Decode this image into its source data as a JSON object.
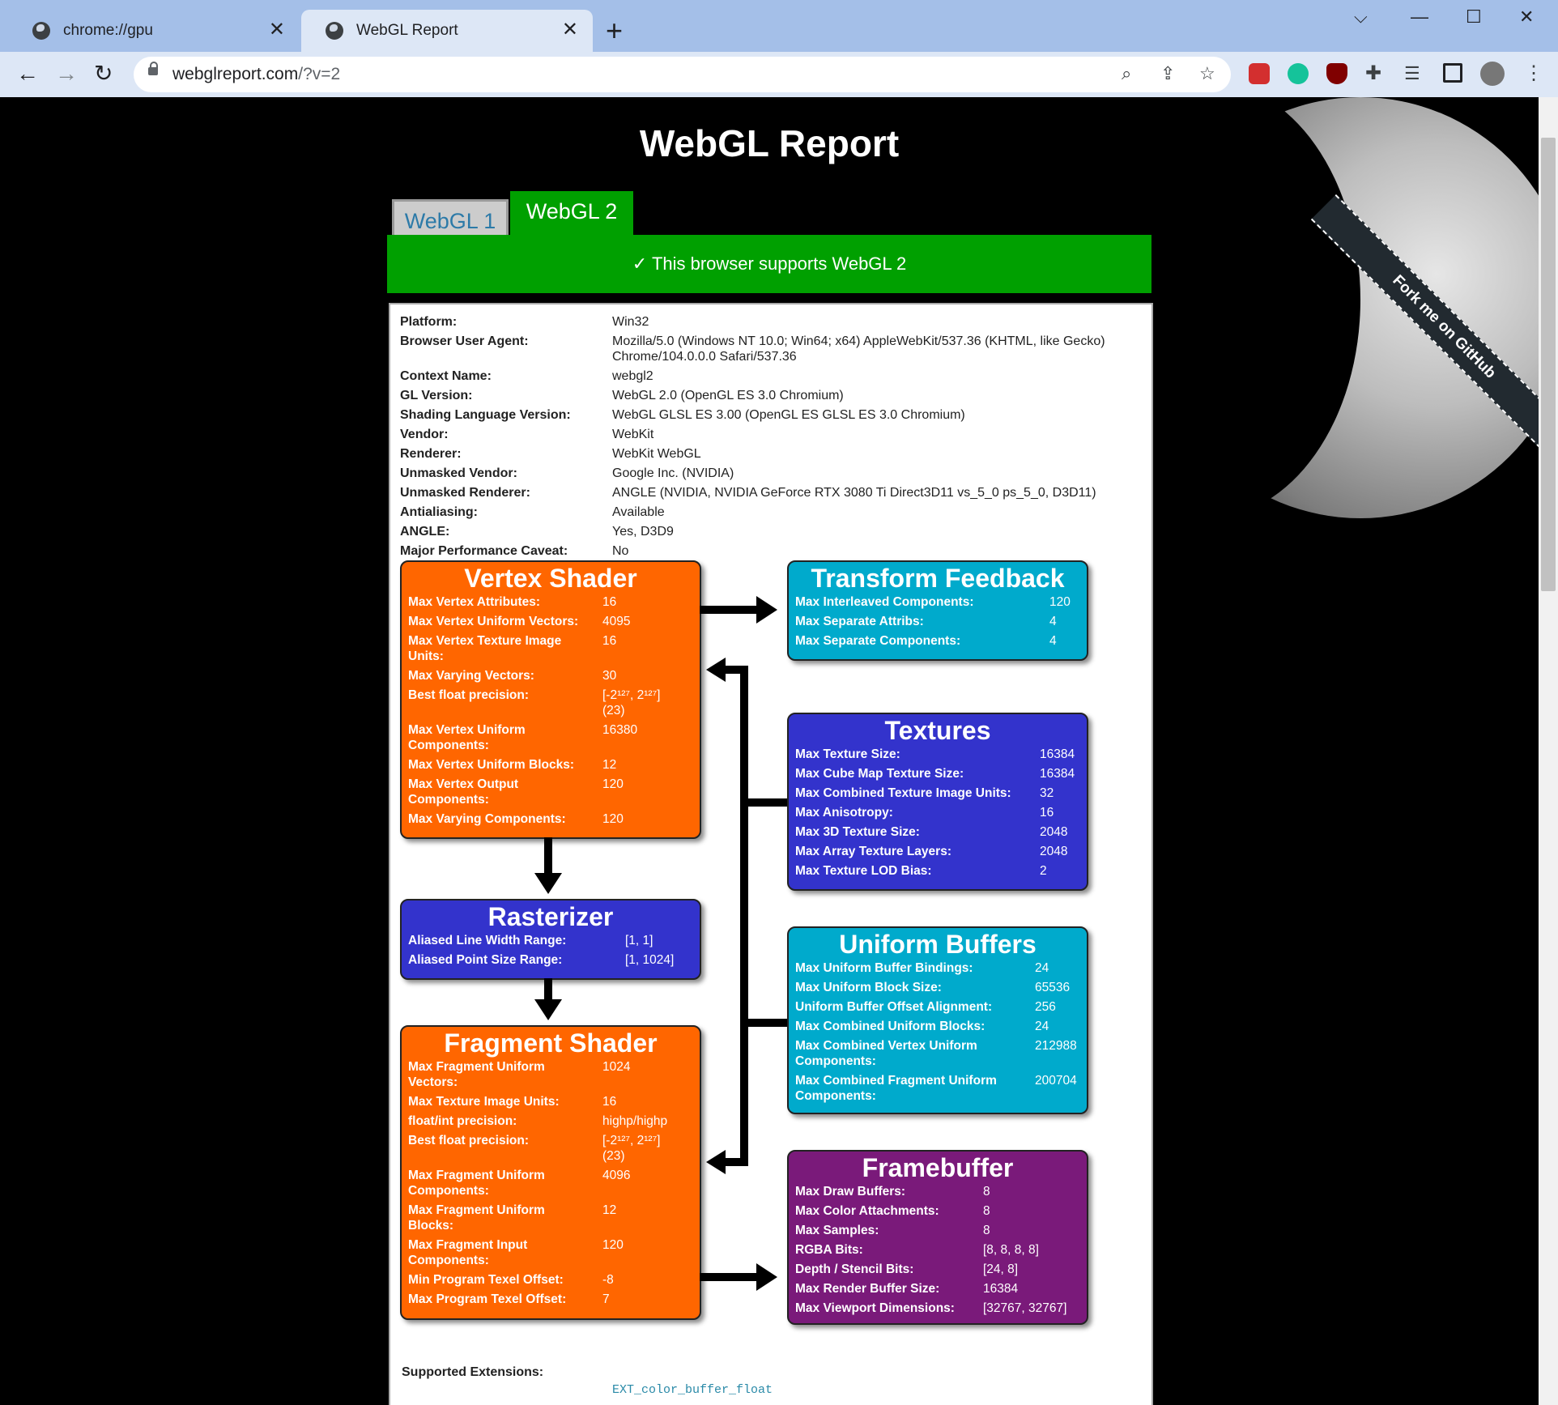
{
  "browser": {
    "tabs": [
      {
        "label": "chrome://gpu",
        "close": "✕"
      },
      {
        "label": "WebGL Report",
        "close": "✕"
      }
    ],
    "new_tab": "+",
    "window_controls": {
      "chevron": "⌵",
      "minimize": "—",
      "maximize": "☐",
      "close": "✕"
    },
    "url_host": "webglreport.com",
    "url_path": "/?v=2"
  },
  "page": {
    "title": "WebGL Report",
    "fork_ribbon": "Fork me on GitHub",
    "tabs": [
      "WebGL 1",
      "WebGL 2"
    ],
    "support_message": "✓ This browser supports WebGL 2",
    "info": [
      {
        "k": "Platform:",
        "v": "Win32"
      },
      {
        "k": "Browser User Agent:",
        "v": "Mozilla/5.0 (Windows NT 10.0; Win64; x64) AppleWebKit/537.36 (KHTML, like Gecko) Chrome/104.0.0.0 Safari/537.36"
      },
      {
        "k": "Context Name:",
        "v": "webgl2"
      },
      {
        "k": "GL Version:",
        "v": "WebGL 2.0 (OpenGL ES 3.0 Chromium)"
      },
      {
        "k": "Shading Language Version:",
        "v": "WebGL GLSL ES 3.00 (OpenGL ES GLSL ES 3.0 Chromium)"
      },
      {
        "k": "Vendor:",
        "v": "WebKit"
      },
      {
        "k": "Renderer:",
        "v": "WebKit WebGL"
      },
      {
        "k": "Unmasked Vendor:",
        "v": "Google Inc. (NVIDIA)"
      },
      {
        "k": "Unmasked Renderer:",
        "v": "ANGLE (NVIDIA, NVIDIA GeForce RTX 3080 Ti Direct3D11 vs_5_0 ps_5_0, D3D11)"
      },
      {
        "k": "Antialiasing:",
        "v": "Available"
      },
      {
        "k": "ANGLE:",
        "v": "Yes, D3D9"
      },
      {
        "k": "Major Performance Caveat:",
        "v": "No"
      }
    ],
    "vertex_shader": {
      "title": "Vertex Shader",
      "rows": [
        {
          "k": "Max Vertex Attributes:",
          "v": "16"
        },
        {
          "k": "Max Vertex Uniform Vectors:",
          "v": "4095"
        },
        {
          "k": "Max Vertex Texture Image Units:",
          "v": "16"
        },
        {
          "k": "Max Varying Vectors:",
          "v": "30"
        },
        {
          "k": "Best float precision:",
          "v": "[-2¹²⁷, 2¹²⁷] (23)"
        },
        {
          "k": "Max Vertex Uniform Components:",
          "v": "16380"
        },
        {
          "k": "Max Vertex Uniform Blocks:",
          "v": "12"
        },
        {
          "k": "Max Vertex Output Components:",
          "v": "120"
        },
        {
          "k": "Max Varying Components:",
          "v": "120"
        }
      ]
    },
    "rasterizer": {
      "title": "Rasterizer",
      "rows": [
        {
          "k": "Aliased Line Width Range:",
          "v": "[1, 1]"
        },
        {
          "k": "Aliased Point Size Range:",
          "v": "[1, 1024]"
        }
      ]
    },
    "fragment_shader": {
      "title": "Fragment Shader",
      "rows": [
        {
          "k": "Max Fragment Uniform Vectors:",
          "v": "1024"
        },
        {
          "k": "Max Texture Image Units:",
          "v": "16"
        },
        {
          "k": "float/int precision:",
          "v": "highp/highp"
        },
        {
          "k": "Best float precision:",
          "v": "[-2¹²⁷, 2¹²⁷] (23)"
        },
        {
          "k": "Max Fragment Uniform Components:",
          "v": "4096"
        },
        {
          "k": "Max Fragment Uniform Blocks:",
          "v": "12"
        },
        {
          "k": "Max Fragment Input Components:",
          "v": "120"
        },
        {
          "k": "Min Program Texel Offset:",
          "v": "-8"
        },
        {
          "k": "Max Program Texel Offset:",
          "v": "7"
        }
      ]
    },
    "transform_feedback": {
      "title": "Transform Feedback",
      "rows": [
        {
          "k": "Max Interleaved Components:",
          "v": "120"
        },
        {
          "k": "Max Separate Attribs:",
          "v": "4"
        },
        {
          "k": "Max Separate Components:",
          "v": "4"
        }
      ]
    },
    "textures": {
      "title": "Textures",
      "rows": [
        {
          "k": "Max Texture Size:",
          "v": "16384"
        },
        {
          "k": "Max Cube Map Texture Size:",
          "v": "16384"
        },
        {
          "k": "Max Combined Texture Image Units:",
          "v": "32"
        },
        {
          "k": "Max Anisotropy:",
          "v": "16"
        },
        {
          "k": "Max 3D Texture Size:",
          "v": "2048"
        },
        {
          "k": "Max Array Texture Layers:",
          "v": "2048"
        },
        {
          "k": "Max Texture LOD Bias:",
          "v": "2"
        }
      ]
    },
    "uniform_buffers": {
      "title": "Uniform Buffers",
      "rows": [
        {
          "k": "Max Uniform Buffer Bindings:",
          "v": "24"
        },
        {
          "k": "Max Uniform Block Size:",
          "v": "65536"
        },
        {
          "k": "Uniform Buffer Offset Alignment:",
          "v": "256"
        },
        {
          "k": "Max Combined Uniform Blocks:",
          "v": "24"
        },
        {
          "k": "Max Combined Vertex Uniform Components:",
          "v": "212988"
        },
        {
          "k": "Max Combined Fragment Uniform Components:",
          "v": "200704"
        }
      ]
    },
    "framebuffer": {
      "title": "Framebuffer",
      "rows": [
        {
          "k": "Max Draw Buffers:",
          "v": "8"
        },
        {
          "k": "Max Color Attachments:",
          "v": "8"
        },
        {
          "k": "Max Samples:",
          "v": "8"
        },
        {
          "k": "RGBA Bits:",
          "v": "[8, 8, 8, 8]"
        },
        {
          "k": "Depth / Stencil Bits:",
          "v": "[24, 8]"
        },
        {
          "k": "Max Render Buffer Size:",
          "v": "16384"
        },
        {
          "k": "Max Viewport Dimensions:",
          "v": "[32767, 32767]"
        }
      ]
    },
    "extensions_label": "Supported Extensions:",
    "first_extension": "EXT_color_buffer_float"
  }
}
